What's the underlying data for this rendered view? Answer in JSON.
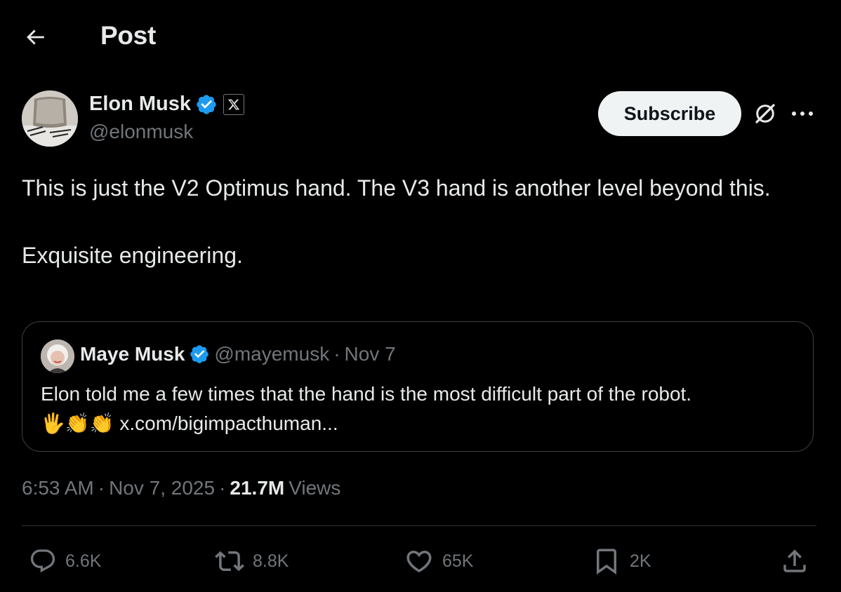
{
  "header": {
    "title": "Post",
    "back_icon": "arrow-left-icon"
  },
  "author": {
    "name": "Elon Musk",
    "handle": "@elonmusk",
    "verified_color": "#1d9bf0",
    "affiliate_badge": "X"
  },
  "controls": {
    "subscribe_label": "Subscribe"
  },
  "post": {
    "line1": "This is just the V2 Optimus hand. The V3 hand is another level beyond this.",
    "line2": "Exquisite engineering."
  },
  "quote": {
    "name": "Maye Musk",
    "handle": "@mayemusk",
    "separator": "·",
    "date": "Nov 7",
    "text": "Elon told me a few times that the hand is the most difficult part of the robot.",
    "emojis": "🖐👏👏",
    "link": "x.com/bigimpacthuman..."
  },
  "meta": {
    "time": "6:53 AM",
    "sep1": "·",
    "date": "Nov 7, 2025",
    "sep2": "·",
    "views_count": "21.7M",
    "views_label": "Views"
  },
  "actions": {
    "replies": "6.6K",
    "reposts": "8.8K",
    "likes": "65K",
    "bookmarks": "2K"
  },
  "colors": {
    "background": "#000000",
    "text": "#e7e9ea",
    "muted": "#71767b",
    "border": "#2f3336",
    "verified": "#1d9bf0"
  }
}
